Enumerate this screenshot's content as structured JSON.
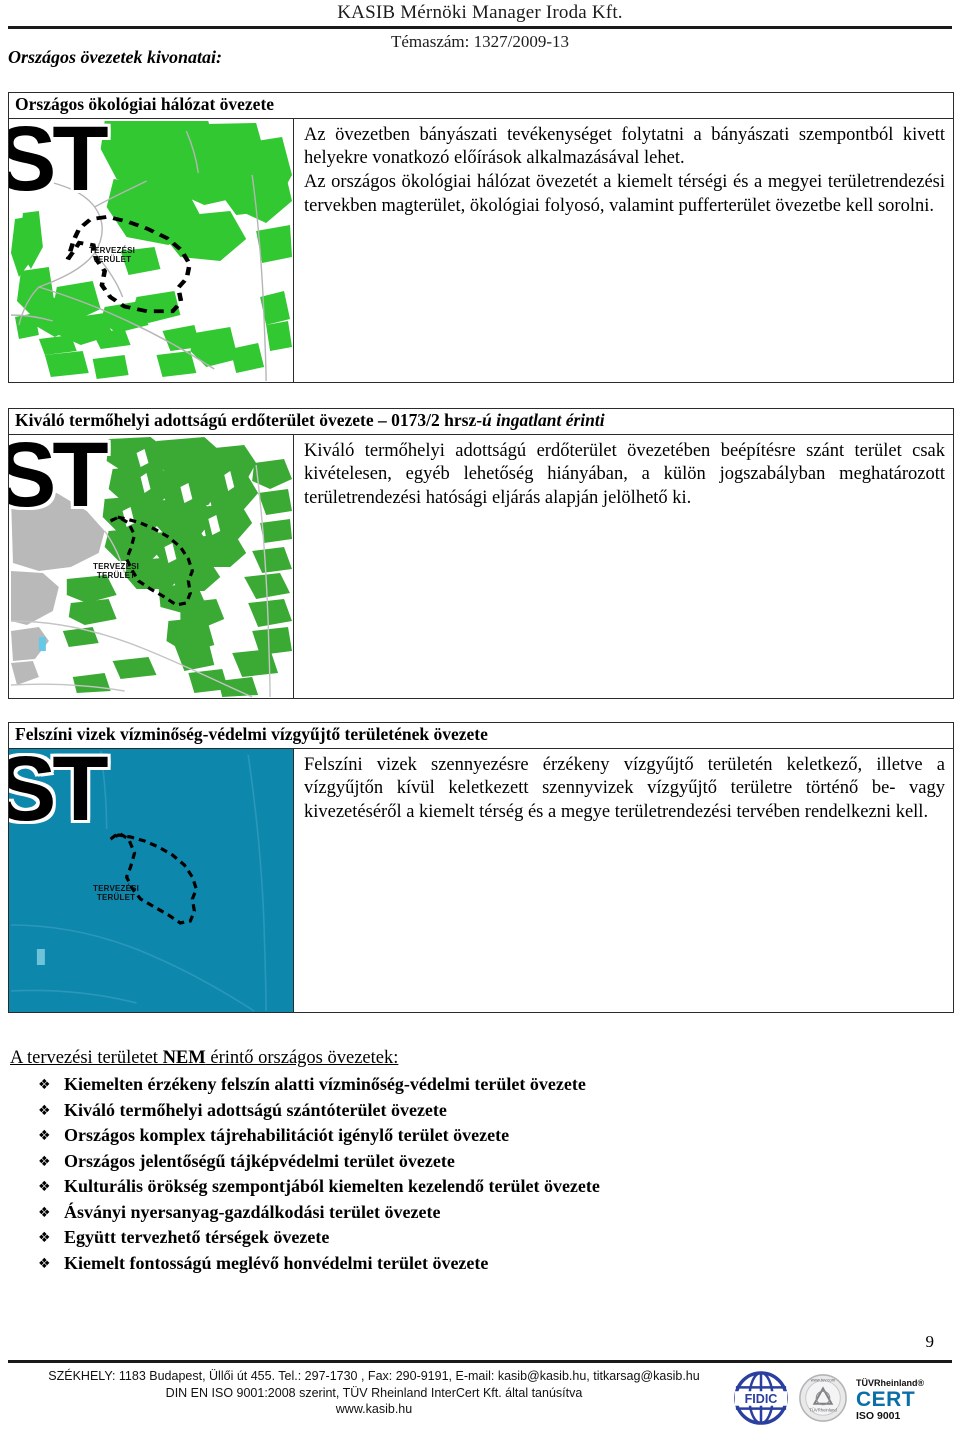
{
  "header": {
    "company": "KASIB Mérnöki Manager Iroda Kft.",
    "topic": "Témaszám: 1327/2009-13",
    "doc_title": "Országos övezetek kivonatai:"
  },
  "sections": [
    {
      "title": "Országos ökológiai hálózat övezete",
      "title_italic_suffix": "",
      "body": "Az övezetben bányászati tevékenységet folytatni a bányászati szempontból kivett helyekre vonatkozó előírások alkalmazásával lehet.\nAz országos ökológiai hálózat övezetét a kiemelt térségi és a megyei területrendezési tervekben magterület, ökológiai folyosó, valamint pufferterület övezetbe kell sorolni.",
      "map": {
        "wordmark": "ST",
        "area_label": "TERVEZÉSI\nTERÜLET",
        "overlay_color": "#32c832",
        "background_color": "#ffffff",
        "style": "ecological"
      }
    },
    {
      "title": "Kiváló termőhelyi adottságú erdőterület övezete – 0173/2 hrsz-",
      "title_italic_suffix": "ú ingatlant érinti",
      "body": "Kiváló termőhelyi adottságú erdőterület övezetében beépítésre szánt terület csak kivételesen, egyéb lehetőség hiányában, a külön jogszabályban meghatározott területrendezési hatósági eljárás alapján jelölhető ki.",
      "map": {
        "wordmark": "ST",
        "area_label": "TERVEZÉSI\nTERÜLET",
        "overlay_color": "#3aaa35",
        "background_color": "#ffffff",
        "style": "forest"
      }
    },
    {
      "title": "Felszíni vizek vízminőség-védelmi vízgyűjtő területének övezete",
      "title_italic_suffix": "",
      "body": "Felszíni vizek szennyezésre érzékeny vízgyűjtő területén keletkező, illetve a vízgyűjtőn kívül keletkezett szennyvizek vízgyűjtő területre történő be- vagy kivezetéséről a kiemelt térség és a megye területrendezési tervében rendelkezni kell.",
      "map": {
        "wordmark": "ST",
        "area_label": "TERVEZÉSI\nTERÜLET",
        "overlay_color": "#0e87ad",
        "background_color": "#0e87ad",
        "style": "water"
      }
    }
  ],
  "not_affected": {
    "title_prefix": "A tervezési területet ",
    "title_strong": "NEM",
    "title_suffix": " érintő országos övezetek:",
    "bullet_glyph": "❖",
    "items": [
      "Kiemelten érzékeny felszín alatti vízminőség-védelmi terület övezete",
      "Kiváló termőhelyi adottságú szántóterület övezete",
      "Országos komplex tájrehabilitációt igénylő terület övezete",
      "Országos jelentőségű tájképvédelmi terület övezete",
      "Kulturális örökség szempontjából kiemelten kezelendő terület övezete",
      "Ásványi nyersanyag-gazdálkodási terület övezete",
      "Együtt tervezhető térségek övezete",
      "Kiemelt fontosságú meglévő honvédelmi terület övezete"
    ]
  },
  "page_number": "9",
  "footer": {
    "line1": "SZÉKHELY: 1183 Budapest, Üllői út 455. Tel.: 297-1730 , Fax: 290-9191, E-mail: kasib@kasib.hu, titkarsag@kasib.hu",
    "line2": "DIN EN ISO 9001:2008 szerint, TÜV Rheinland InterCert Kft. által tanúsítva",
    "line3": "www.kasib.hu",
    "logos": {
      "fidic_label": "FIDIC",
      "tuv_seal_label": "TÜVRheinland",
      "tuv_seal_url": "www.tuv.com",
      "cert_top": "TÜVRheinland®",
      "cert_mid": "CERT",
      "cert_bot": "ISO 9001"
    }
  },
  "colors": {
    "green": "#32c832",
    "forest_green": "#3aaa35",
    "water_teal": "#0e87ad",
    "grey_area": "#b9b9b9",
    "cert_blue": "#0a6ea8",
    "fidic_blue": "#2b3f9e",
    "rule": "#1a1a1a"
  }
}
